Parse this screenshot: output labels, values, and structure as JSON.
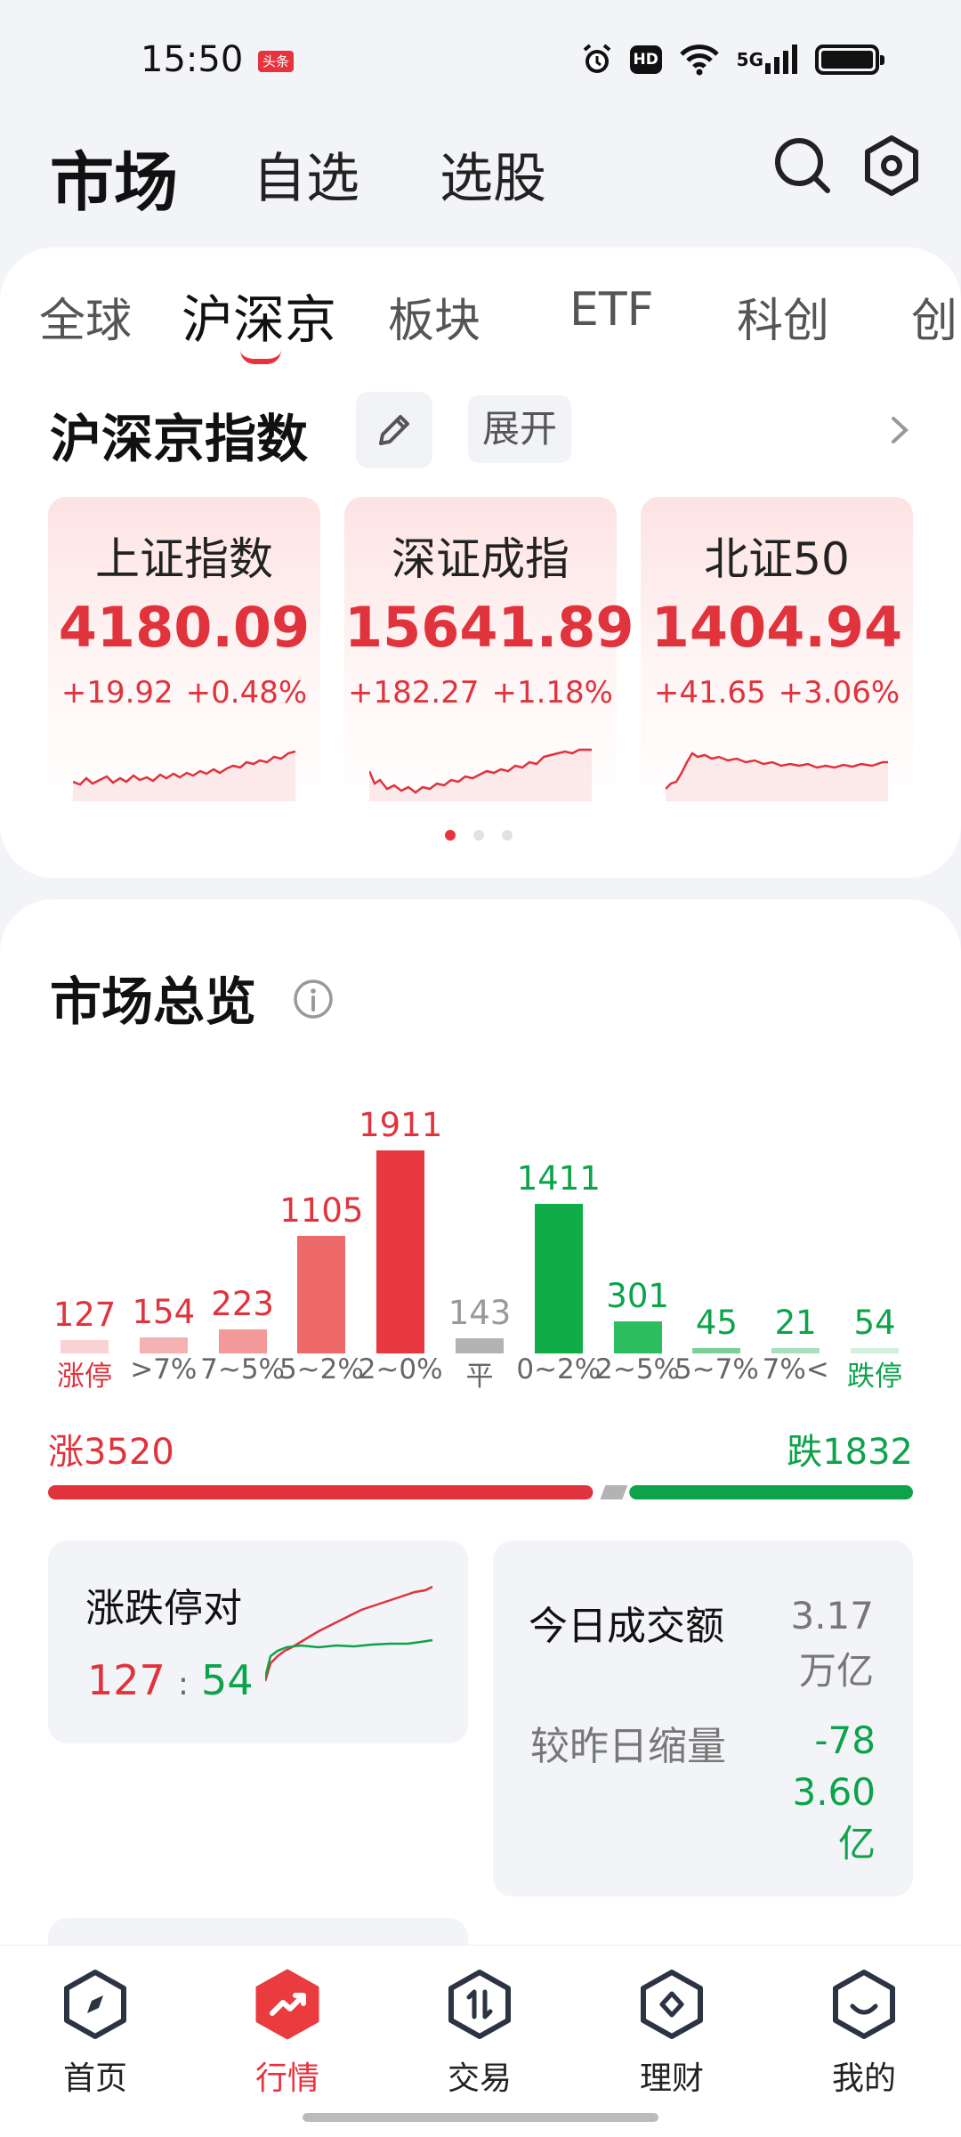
{
  "status_bar": {
    "time": "15:50",
    "badge": "头条",
    "hd": "HD",
    "network": "5G"
  },
  "top_nav": {
    "tabs": [
      {
        "label": "市场",
        "active": true
      },
      {
        "label": "自选"
      },
      {
        "label": "选股"
      }
    ],
    "icons": [
      "search-icon",
      "settings-icon"
    ]
  },
  "sub_tabs": [
    {
      "label": "全球"
    },
    {
      "label": "沪深京",
      "active": true
    },
    {
      "label": "板块"
    },
    {
      "label": "ETF"
    },
    {
      "label": "科创"
    },
    {
      "label": "创"
    }
  ],
  "index_section": {
    "title": "沪深京指数",
    "expand_label": "展开",
    "indices": [
      {
        "name": "上证指数",
        "value": "4180.09",
        "change": "+19.92",
        "pct": "+0.48%"
      },
      {
        "name": "深证成指",
        "value": "15641.89",
        "change": "+182.27",
        "pct": "+1.18%"
      },
      {
        "name": "北证50",
        "value": "1404.94",
        "change": "+41.65",
        "pct": "+3.06%"
      }
    ],
    "page_count": 3,
    "active_page": 1
  },
  "overview": {
    "title": "市场总览",
    "rise_label": "涨3520",
    "fall_label": "跌1832",
    "ratio": {
      "rise": 3520,
      "flat": 143,
      "fall": 1832
    }
  },
  "chart_data": {
    "type": "bar",
    "categories": [
      "涨停",
      ">7%",
      "7~5%",
      "5~2%",
      "2~0%",
      "平",
      "0~2%",
      "2~5%",
      "5~7%",
      "7%<",
      "跌停"
    ],
    "values": [
      127,
      154,
      223,
      1105,
      1911,
      143,
      1411,
      301,
      45,
      21,
      54
    ],
    "value_labels": [
      "127",
      "154",
      "223",
      "1105",
      "1911",
      "143",
      "1411",
      "301",
      "45",
      "21",
      "54"
    ],
    "colors": [
      "#f9d3d3",
      "#f5b2b2",
      "#f29a9a",
      "#ee6a6a",
      "#e8383f",
      "#b3b3b3",
      "#0fac48",
      "#2bbd5f",
      "#7ccf96",
      "#a8dfba",
      "#d3efdd"
    ],
    "text_colors": [
      "#e0333c",
      "#e0333c",
      "#e0333c",
      "#e0333c",
      "#e0333c",
      "#999999",
      "#0da34a",
      "#0da34a",
      "#0da34a",
      "#0da34a",
      "#0da34a"
    ],
    "label_colors": [
      "#e0333c",
      "#666666",
      "#666666",
      "#666666",
      "#666666",
      "#666666",
      "#666666",
      "#666666",
      "#666666",
      "#666666",
      "#0da34a"
    ],
    "title": "",
    "xlabel": "",
    "ylabel": ""
  },
  "limit_card": {
    "title": "涨跌停对",
    "up": "127",
    "separator": ":",
    "down": "54"
  },
  "turnover_card": {
    "title": "今日成交额",
    "value": "3.17万亿",
    "change_label": "较昨日缩量",
    "change_value": "-783.60亿"
  },
  "bottom_nav": [
    {
      "label": "首页",
      "icon": "compass-icon"
    },
    {
      "label": "行情",
      "icon": "trend-icon",
      "active": true
    },
    {
      "label": "交易",
      "icon": "exchange-icon"
    },
    {
      "label": "理财",
      "icon": "wealth-icon"
    },
    {
      "label": "我的",
      "icon": "profile-icon"
    }
  ],
  "colors": {
    "up": "#e0333c",
    "down": "#0da34a",
    "accent": "#e8323c"
  }
}
